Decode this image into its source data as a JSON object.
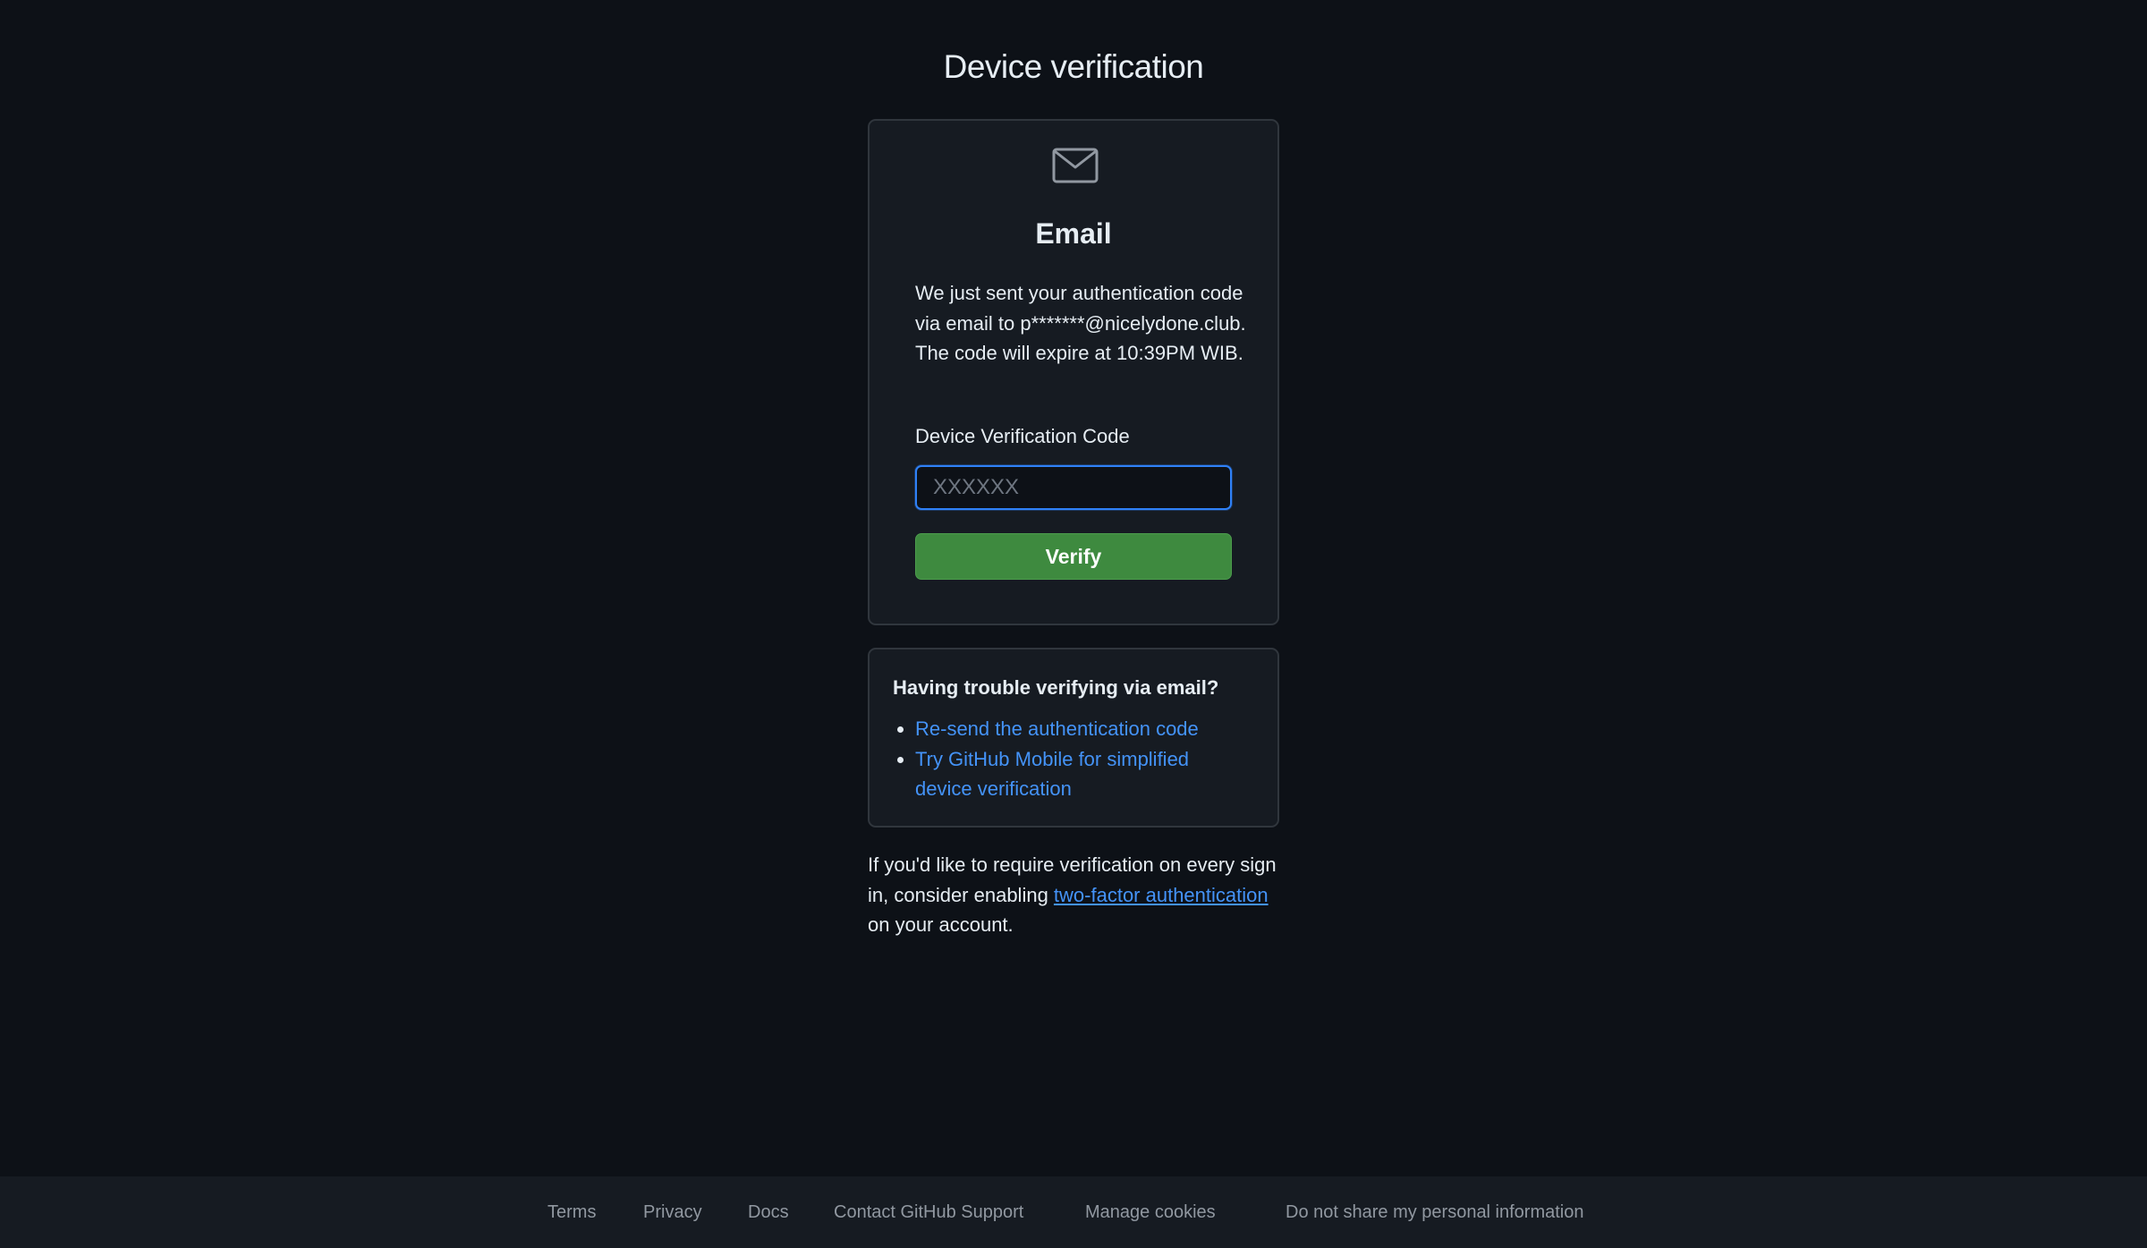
{
  "page": {
    "title": "Device verification"
  },
  "verify_card": {
    "icon": "mail-icon",
    "heading": "Email",
    "description": "We just sent your authentication code via email to p*******@nicelydone.club. The code will expire at 10:39PM WIB.",
    "field_label": "Device Verification Code",
    "field_value": "",
    "field_placeholder": "XXXXXX",
    "button_label": "Verify",
    "button_color": "#3e8a3f",
    "focus_color": "#2f81f7"
  },
  "trouble_card": {
    "heading": "Having trouble verifying via email?",
    "links": [
      "Re-send the authentication code",
      "Try GitHub Mobile for simplified device verification"
    ],
    "link_color": "#4493f8"
  },
  "footnote": {
    "before": "If you'd like to require verification on every sign in, consider enabling ",
    "link": "two-factor authentication",
    "after": " on your account."
  },
  "footer": {
    "links": [
      "Terms",
      "Privacy",
      "Docs",
      "Contact GitHub Support",
      "Manage cookies",
      "Do not share my personal information"
    ]
  }
}
